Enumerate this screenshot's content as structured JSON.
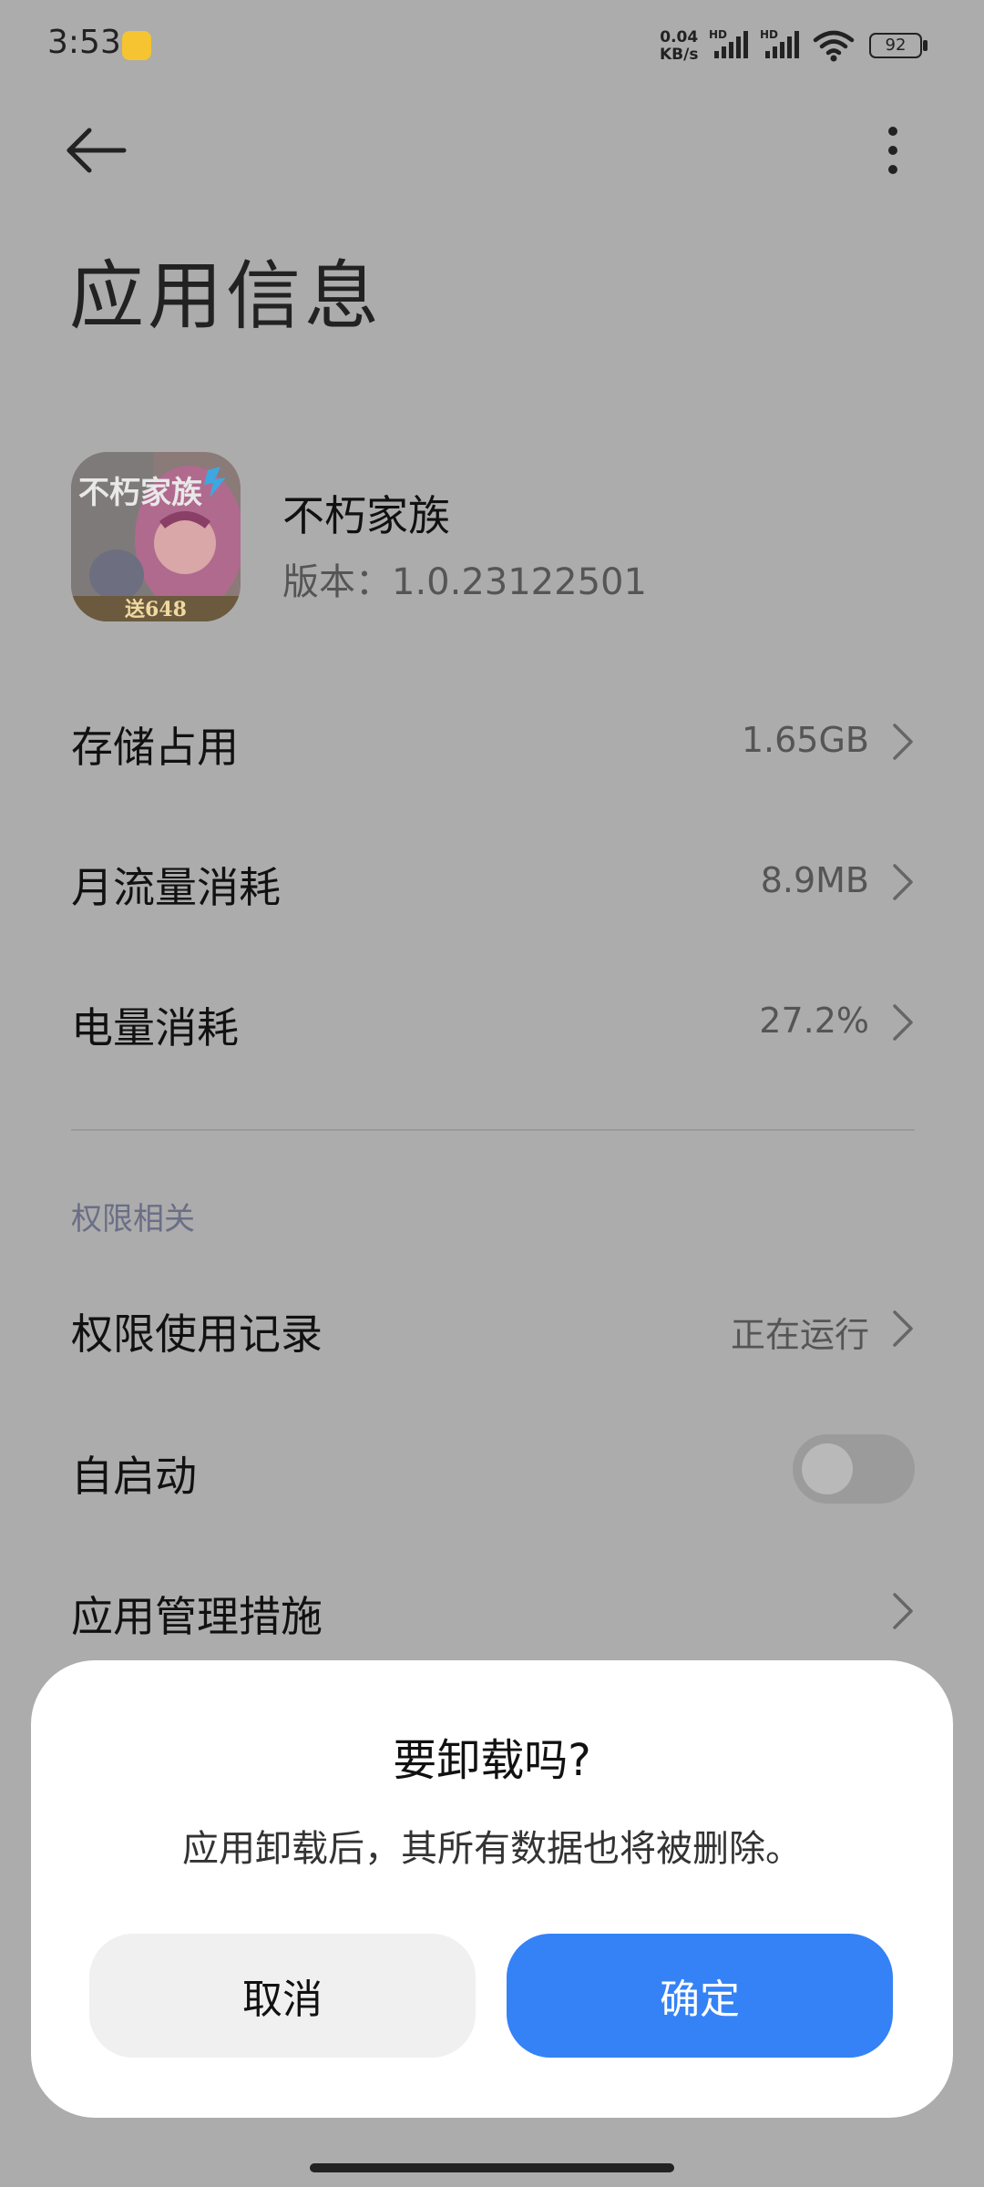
{
  "status_bar": {
    "time": "3:53",
    "net_speed_value": "0.04",
    "net_speed_unit": "KB/s",
    "signal1_label": "HD",
    "signal2_label": "HD",
    "battery": "92"
  },
  "header": {
    "title": "应用信息",
    "back_icon": "arrow-left-icon",
    "more_icon": "more-vertical-icon"
  },
  "app": {
    "name": "不朽家族",
    "version": "版本：1.0.23122501",
    "icon_caption": "送648",
    "icon_title": "不朽家族"
  },
  "rows": [
    {
      "label": "存储占用",
      "value": "1.65GB"
    },
    {
      "label": "月流量消耗",
      "value": "8.9MB"
    },
    {
      "label": "电量消耗",
      "value": "27.2%"
    }
  ],
  "permissions": {
    "section_title": "权限相关",
    "usage_label": "权限使用记录",
    "usage_value": "正在运行",
    "autostart_label": "自启动",
    "autostart_on": false,
    "management_label": "应用管理措施"
  },
  "dialog": {
    "title": "要卸载吗?",
    "message": "应用卸载后，其所有数据也将被删除。",
    "cancel_label": "取消",
    "confirm_label": "确定"
  },
  "colors": {
    "accent": "#3482f6",
    "dim_background": "#acacac"
  }
}
